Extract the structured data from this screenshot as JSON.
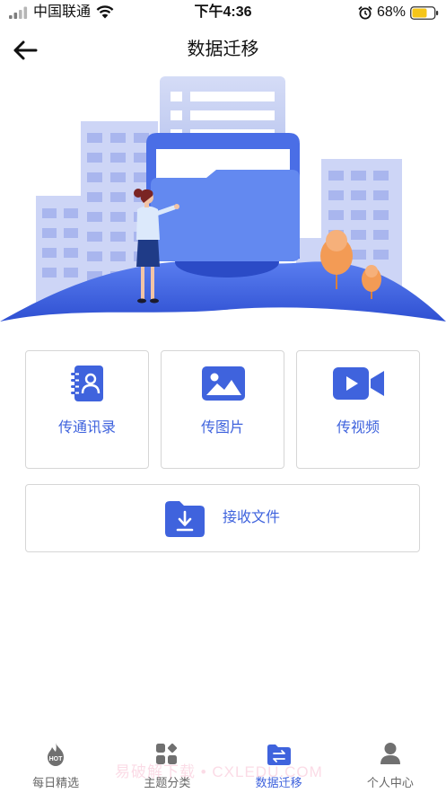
{
  "status_bar": {
    "carrier": "中国联通",
    "time": "下午4:36",
    "battery_percent": "68%",
    "battery_level": 0.68,
    "icons": [
      "signal-icon",
      "wifi-icon",
      "alarm-icon",
      "battery-icon"
    ]
  },
  "header": {
    "title": "数据迁移",
    "back_icon": "back-arrow-icon"
  },
  "actions": [
    {
      "label": "传通讯录",
      "icon": "contacts-icon"
    },
    {
      "label": "传图片",
      "icon": "image-icon"
    },
    {
      "label": "传视频",
      "icon": "video-icon"
    }
  ],
  "receive": {
    "label": "接收文件",
    "icon": "folder-download-icon"
  },
  "tabs": [
    {
      "label": "每日精选",
      "icon": "hot-flame-icon",
      "badge": "HOT",
      "active": false
    },
    {
      "label": "主题分类",
      "icon": "category-grid-icon",
      "active": false
    },
    {
      "label": "数据迁移",
      "icon": "data-migration-icon",
      "active": true
    },
    {
      "label": "个人中心",
      "icon": "person-icon",
      "active": false
    }
  ],
  "watermark": "易破解下载 • CXLEDU.COM",
  "colors": {
    "accent": "#3f63dd",
    "tab_inactive": "#666666",
    "battery": "#f5c518",
    "card_border": "#d6d6d6"
  }
}
